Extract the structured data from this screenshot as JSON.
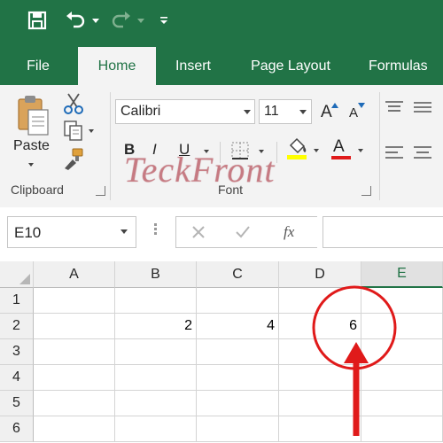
{
  "qat": {
    "save_icon": "save-icon",
    "undo_icon": "undo-icon",
    "redo_icon": "redo-icon",
    "customize_icon": "customize-qat-icon"
  },
  "tabs": [
    {
      "label": "File"
    },
    {
      "label": "Home"
    },
    {
      "label": "Insert"
    },
    {
      "label": "Page Layout"
    },
    {
      "label": "Formulas"
    }
  ],
  "ribbon": {
    "clipboard": {
      "paste_label": "Paste",
      "group_label": "Clipboard"
    },
    "font": {
      "font_name": "Calibri",
      "font_size": "11",
      "group_label": "Font",
      "bold": "B",
      "italic": "I",
      "underline": "U",
      "font_color_letter": "A",
      "grow": "A",
      "shrink": "A"
    }
  },
  "watermark": "TeckFront",
  "formula_bar": {
    "name_box": "E10",
    "fx": "fx",
    "value": ""
  },
  "columns": [
    "A",
    "B",
    "C",
    "D",
    "E"
  ],
  "selected_column": "E",
  "rows": [
    {
      "num": "1",
      "cells": [
        "",
        "",
        "",
        "",
        ""
      ]
    },
    {
      "num": "2",
      "cells": [
        "",
        "2",
        "4",
        "6",
        ""
      ]
    },
    {
      "num": "3",
      "cells": [
        "",
        "",
        "",
        "",
        ""
      ]
    },
    {
      "num": "4",
      "cells": [
        "",
        "",
        "",
        "",
        ""
      ]
    },
    {
      "num": "5",
      "cells": [
        "",
        "",
        "",
        "",
        ""
      ]
    },
    {
      "num": "6",
      "cells": [
        "",
        "",
        "",
        "",
        ""
      ]
    }
  ],
  "colors": {
    "excel_green": "#217346",
    "annotation_red": "#e01a1a"
  }
}
